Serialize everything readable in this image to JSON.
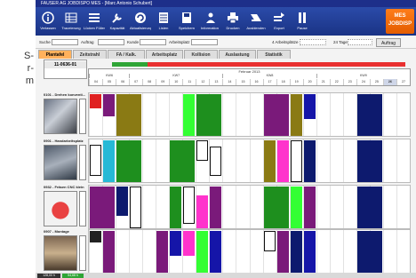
{
  "side_text": [
    "S-",
    "r-",
    "m"
  ],
  "app": {
    "window_title": "FAUSER AG JOBDISPO MES - [Marc Antonio Schubert]",
    "brand_line1": "MES",
    "brand_line2": "JOBDISP",
    "toolbar": [
      {
        "label": "Verlassen",
        "icon": "info-icon"
      },
      {
        "label": "Traceierung",
        "icon": "grid-icon"
      },
      {
        "label": "Lücken Füllen",
        "icon": "list-icon"
      },
      {
        "label": "Kapazität",
        "icon": "wrench-icon"
      },
      {
        "label": "Aktualisierung",
        "icon": "refresh-icon"
      },
      {
        "label": "Listen",
        "icon": "table-icon"
      },
      {
        "label": "Speichern",
        "icon": "save-icon"
      },
      {
        "label": "Information",
        "icon": "info-person-icon"
      },
      {
        "label": "Drucken",
        "icon": "print-icon"
      },
      {
        "label": "Ausblenden",
        "icon": "hide-icon"
      },
      {
        "label": "Export",
        "icon": "export-icon"
      },
      {
        "label": "Pause",
        "icon": "pause-icon"
      }
    ],
    "filters": {
      "search": "Suche",
      "order": "Auftrag",
      "customer": "Kunde",
      "article": "Arbeitsplatz",
      "workplace_count": "4 Arbeitsplätze",
      "days": "24 Tage",
      "button": "Auftrag"
    },
    "tabs": [
      {
        "label": "Plantafel",
        "active": true
      },
      {
        "label": "Zeitstrahl",
        "active": false
      },
      {
        "label": "FA / Kalk.",
        "active": false
      },
      {
        "label": "Arbeitsplatz",
        "active": false
      },
      {
        "label": "Kollision",
        "active": false
      },
      {
        "label": "Auslastung",
        "active": false
      },
      {
        "label": "Statistik",
        "active": false
      }
    ],
    "order_id": "11-0636-01",
    "progress_pct": 0.12,
    "calendar": {
      "month": "Februar 2013",
      "weeks": [
        "KW6",
        "KW7",
        "KW8",
        "KW9"
      ],
      "days": [
        "04",
        "05",
        "06",
        "07",
        "08",
        "09",
        "10",
        "11",
        "12",
        "13",
        "14",
        "15",
        "16",
        "17",
        "18",
        "19",
        "20",
        "21",
        "22",
        "23",
        "24",
        "25",
        "26",
        "27"
      ],
      "selected_day": "26"
    },
    "resources": [
      {
        "name": "0101 - Drehen konventi...",
        "photo": "lathe"
      },
      {
        "name": "0901 - Handarbeitsplatz",
        "photo": "workbench"
      },
      {
        "name": "0932 - Fräsen CNC klein",
        "photo": "cnc"
      },
      {
        "name": "0907 - Montage",
        "photo": "assembly"
      }
    ],
    "status": [
      "128,00 h",
      "54,68 h"
    ]
  }
}
